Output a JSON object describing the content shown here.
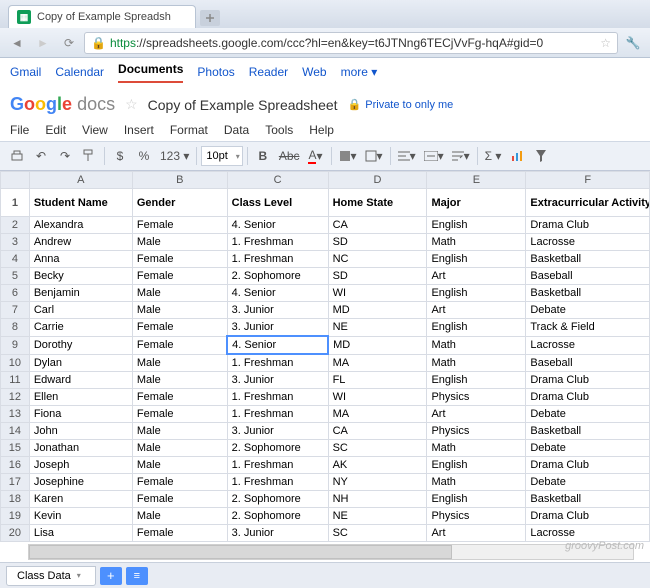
{
  "browser": {
    "tab_title": "Copy of Example Spreadsh",
    "url_https": "https",
    "url_rest": "://spreadsheets.google.com/ccc?hl=en&key=t6JTNng6TECjVvFg-hqA#gid=0"
  },
  "gbar": {
    "gmail": "Gmail",
    "calendar": "Calendar",
    "documents": "Documents",
    "photos": "Photos",
    "reader": "Reader",
    "web": "Web",
    "more": "more ▾"
  },
  "docs": {
    "logo_docs": "docs",
    "title": "Copy of Example Spreadsheet",
    "privacy": "Private to only me"
  },
  "menu": {
    "file": "File",
    "edit": "Edit",
    "view": "View",
    "insert": "Insert",
    "format": "Format",
    "data": "Data",
    "tools": "Tools",
    "help": "Help"
  },
  "toolbar": {
    "currency": "$",
    "percent": "%",
    "more_formats": "123 ▾",
    "font_size": "10pt",
    "bold": "B",
    "strike": "Abc"
  },
  "columns": [
    "A",
    "B",
    "C",
    "D",
    "E",
    "F"
  ],
  "headers": [
    "Student Name",
    "Gender",
    "Class Level",
    "Home State",
    "Major",
    "Extracurricular Activity"
  ],
  "rows": [
    [
      "Alexandra",
      "Female",
      "4. Senior",
      "CA",
      "English",
      "Drama Club"
    ],
    [
      "Andrew",
      "Male",
      "1. Freshman",
      "SD",
      "Math",
      "Lacrosse"
    ],
    [
      "Anna",
      "Female",
      "1. Freshman",
      "NC",
      "English",
      "Basketball"
    ],
    [
      "Becky",
      "Female",
      "2. Sophomore",
      "SD",
      "Art",
      "Baseball"
    ],
    [
      "Benjamin",
      "Male",
      "4. Senior",
      "WI",
      "English",
      "Basketball"
    ],
    [
      "Carl",
      "Male",
      "3. Junior",
      "MD",
      "Art",
      "Debate"
    ],
    [
      "Carrie",
      "Female",
      "3. Junior",
      "NE",
      "English",
      "Track & Field"
    ],
    [
      "Dorothy",
      "Female",
      "4. Senior",
      "MD",
      "Math",
      "Lacrosse"
    ],
    [
      "Dylan",
      "Male",
      "1. Freshman",
      "MA",
      "Math",
      "Baseball"
    ],
    [
      "Edward",
      "Male",
      "3. Junior",
      "FL",
      "English",
      "Drama Club"
    ],
    [
      "Ellen",
      "Female",
      "1. Freshman",
      "WI",
      "Physics",
      "Drama Club"
    ],
    [
      "Fiona",
      "Female",
      "1. Freshman",
      "MA",
      "Art",
      "Debate"
    ],
    [
      "John",
      "Male",
      "3. Junior",
      "CA",
      "Physics",
      "Basketball"
    ],
    [
      "Jonathan",
      "Male",
      "2. Sophomore",
      "SC",
      "Math",
      "Debate"
    ],
    [
      "Joseph",
      "Male",
      "1. Freshman",
      "AK",
      "English",
      "Drama Club"
    ],
    [
      "Josephine",
      "Female",
      "1. Freshman",
      "NY",
      "Math",
      "Debate"
    ],
    [
      "Karen",
      "Female",
      "2. Sophomore",
      "NH",
      "English",
      "Basketball"
    ],
    [
      "Kevin",
      "Male",
      "2. Sophomore",
      "NE",
      "Physics",
      "Drama Club"
    ],
    [
      "Lisa",
      "Female",
      "3. Junior",
      "SC",
      "Art",
      "Lacrosse"
    ]
  ],
  "selected_cell": {
    "row": 9,
    "col": 2
  },
  "sheet_tab": "Class Data",
  "watermark": "groovyPost.com"
}
